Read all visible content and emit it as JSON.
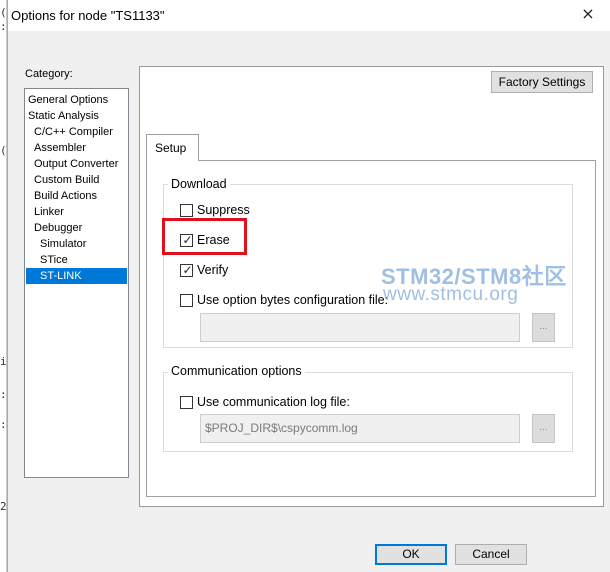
{
  "window": {
    "title": "Options for node \"TS1133\"",
    "close_icon": "×"
  },
  "behind_glyphs": [
    "(",
    ":",
    "(",
    "i",
    ":",
    ":",
    "2"
  ],
  "category": {
    "label": "Category:",
    "items": [
      {
        "label": "General Options",
        "indent": 0,
        "selected": false
      },
      {
        "label": "Static Analysis",
        "indent": 0,
        "selected": false
      },
      {
        "label": "C/C++ Compiler",
        "indent": 1,
        "selected": false
      },
      {
        "label": "Assembler",
        "indent": 1,
        "selected": false
      },
      {
        "label": "Output Converter",
        "indent": 1,
        "selected": false
      },
      {
        "label": "Custom Build",
        "indent": 1,
        "selected": false
      },
      {
        "label": "Build Actions",
        "indent": 1,
        "selected": false
      },
      {
        "label": "Linker",
        "indent": 1,
        "selected": false
      },
      {
        "label": "Debugger",
        "indent": 1,
        "selected": false
      },
      {
        "label": "Simulator",
        "indent": 2,
        "selected": false
      },
      {
        "label": "STice",
        "indent": 2,
        "selected": false
      },
      {
        "label": "ST-LINK",
        "indent": 2,
        "selected": true
      }
    ]
  },
  "factory_settings_label": "Factory Settings",
  "tab": {
    "label": "Setup"
  },
  "download": {
    "label": "Download",
    "suppress": {
      "label": "Suppress",
      "checked": false
    },
    "erase": {
      "label": "Erase",
      "checked": true
    },
    "verify": {
      "label": "Verify",
      "checked": true
    },
    "option_bytes": {
      "label": "Use option bytes configuration file:",
      "checked": false
    },
    "option_bytes_path": "",
    "browse_label": "..."
  },
  "communication": {
    "label": "Communication options",
    "log_file": {
      "label": "Use communication log file:",
      "checked": false
    },
    "log_path": "$PROJ_DIR$\\cspycomm.log",
    "browse_label": "..."
  },
  "watermark": {
    "line1": "STM32/STM8社区",
    "line2": "www.stmcu.org"
  },
  "buttons": {
    "ok": "OK",
    "cancel": "Cancel"
  },
  "colors": {
    "highlight": "#e0101e",
    "selection": "#0078d7",
    "watermark": "#8fb4e0"
  }
}
